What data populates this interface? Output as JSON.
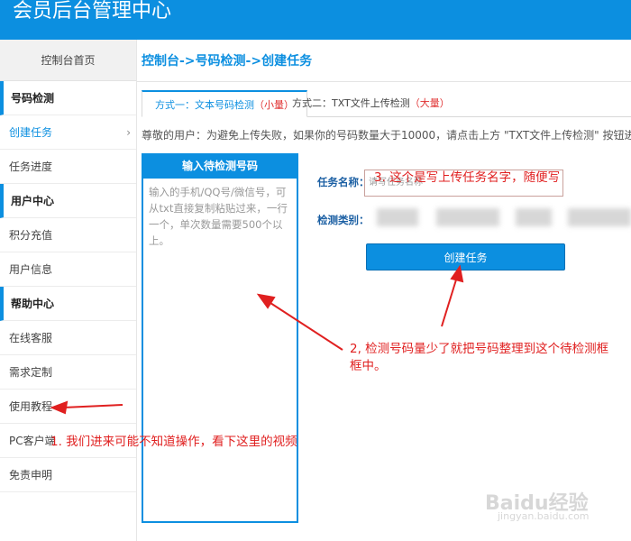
{
  "app": {
    "title": "会员后台管理中心"
  },
  "sidebar": {
    "home": "控制台首页",
    "items": [
      {
        "label": "号码检测",
        "type": "head"
      },
      {
        "label": "创建任务",
        "type": "active"
      },
      {
        "label": "任务进度",
        "type": "item"
      },
      {
        "label": "用户中心",
        "type": "head"
      },
      {
        "label": "积分充值",
        "type": "item"
      },
      {
        "label": "用户信息",
        "type": "item"
      },
      {
        "label": "帮助中心",
        "type": "head"
      },
      {
        "label": "在线客服",
        "type": "item"
      },
      {
        "label": "需求定制",
        "type": "item"
      },
      {
        "label": "使用教程",
        "type": "item"
      },
      {
        "label": "PC客户端",
        "type": "item"
      },
      {
        "label": "免责申明",
        "type": "item"
      }
    ]
  },
  "main": {
    "breadcrumb": "控制台->号码检测->创建任务",
    "tabs": [
      {
        "label": "方式一：文本号码检测",
        "tag": "（小量）"
      },
      {
        "label": "方式二：TXT文件上传检测",
        "tag": "（大量）"
      }
    ],
    "notice": "尊敬的用户：为避免上传失败，如果你的号码数量大于10000，请点击上方 \"TXT文件上传检测\" 按钮进入",
    "input_box": {
      "title": "输入待检测号码",
      "placeholder": "输入的手机/QQ号/微信号，可从txt直接复制粘贴过来，一行一个，单次数量需要500个以上。"
    },
    "form": {
      "task_name_label": "任务名称：",
      "task_name_placeholder": "请写任务名称",
      "category_label": "检测类别：",
      "create_button": "创建任务"
    }
  },
  "annotations": {
    "a1": "1. 我们进来可能不知道操作，看下这里的视频",
    "a2": "2, 检测号码量少了就把号码整理到这个待检测框框中。",
    "a3": "3. 这个是写上传任务名字，随便写"
  },
  "watermark": {
    "brand": "Baidu经验",
    "url": "jingyan.baidu.com"
  },
  "colors": {
    "accent": "#0c8fe0",
    "annotation": "#e02020"
  }
}
